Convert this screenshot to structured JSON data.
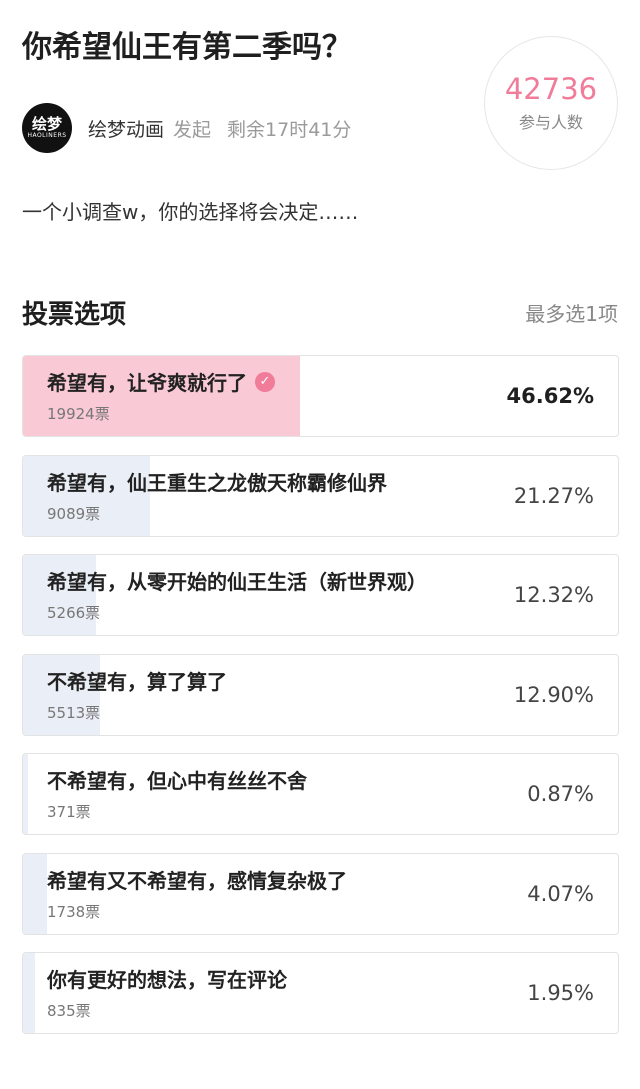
{
  "poll": {
    "title": "你希望仙王有第二季吗？",
    "author": "绘梦动画",
    "author_action": "发起",
    "time_left": "剩余17时41分",
    "avatar_text": "绘梦",
    "avatar_subtext": "HAOLINERS",
    "participants_count": "42736",
    "participants_label": "参与人数",
    "description": "一个小调查w，你的选择将会决定……",
    "section_title": "投票选项",
    "max_select": "最多选1项"
  },
  "colors": {
    "accent": "#f07c9a",
    "selected_fill": "#f9c9d6",
    "bar_fill": "#eaeef6"
  },
  "options": [
    {
      "label": "希望有，让爷爽就行了",
      "votes": "19924票",
      "percent": "46.62%",
      "fraction": 0.4662,
      "selected": true,
      "icon": "check-circle-icon"
    },
    {
      "label": "希望有，仙王重生之龙傲天称霸修仙界",
      "votes": "9089票",
      "percent": "21.27%",
      "fraction": 0.2127,
      "selected": false
    },
    {
      "label": "希望有，从零开始的仙王生活（新世界观）",
      "votes": "5266票",
      "percent": "12.32%",
      "fraction": 0.1232,
      "selected": false
    },
    {
      "label": "不希望有，算了算了",
      "votes": "5513票",
      "percent": "12.90%",
      "fraction": 0.129,
      "selected": false
    },
    {
      "label": "不希望有，但心中有丝丝不舍",
      "votes": "371票",
      "percent": "0.87%",
      "fraction": 0.0087,
      "selected": false
    },
    {
      "label": "希望有又不希望有，感情复杂极了",
      "votes": "1738票",
      "percent": "4.07%",
      "fraction": 0.0407,
      "selected": false
    },
    {
      "label": "你有更好的想法，写在评论",
      "votes": "835票",
      "percent": "1.95%",
      "fraction": 0.0195,
      "selected": false
    }
  ]
}
